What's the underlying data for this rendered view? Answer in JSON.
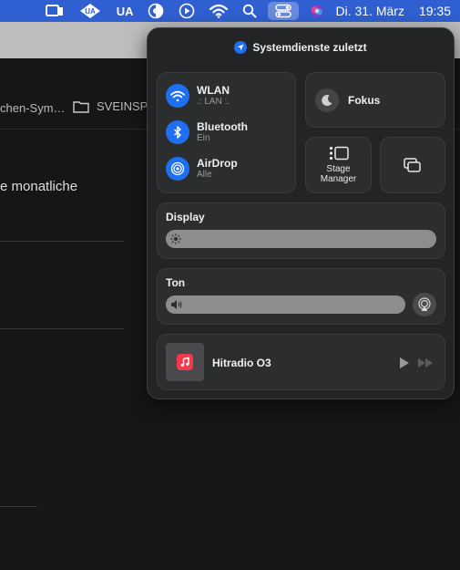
{
  "menubar": {
    "ua_label": "UA",
    "date": "Di. 31. März",
    "time": "19:35",
    "icons": [
      "display-mirror-icon",
      "universal-audio-icon",
      "focus-half-icon",
      "play-circle-icon",
      "wifi-icon",
      "search-icon",
      "control-center-icon",
      "siri-icon"
    ]
  },
  "background": {
    "bookmark_1": "chen-Sym…",
    "bookmark_2": "SVEINSPR",
    "text_line": "e monatliche"
  },
  "control_center": {
    "header": "Systemdienste zuletzt",
    "network": {
      "wlan_title": "WLAN",
      "wlan_sub": ".: LAN :.",
      "bluetooth_title": "Bluetooth",
      "bluetooth_sub": "Ein",
      "airdrop_title": "AirDrop",
      "airdrop_sub": "Alle"
    },
    "focus_label": "Fokus",
    "stage_manager_label": "Stage Manager",
    "display_title": "Display",
    "display_brightness": 1.0,
    "sound_title": "Ton",
    "sound_volume": 1.0,
    "now_playing_title": "Hitradio O3",
    "accent_color": "#1f6ff2"
  }
}
